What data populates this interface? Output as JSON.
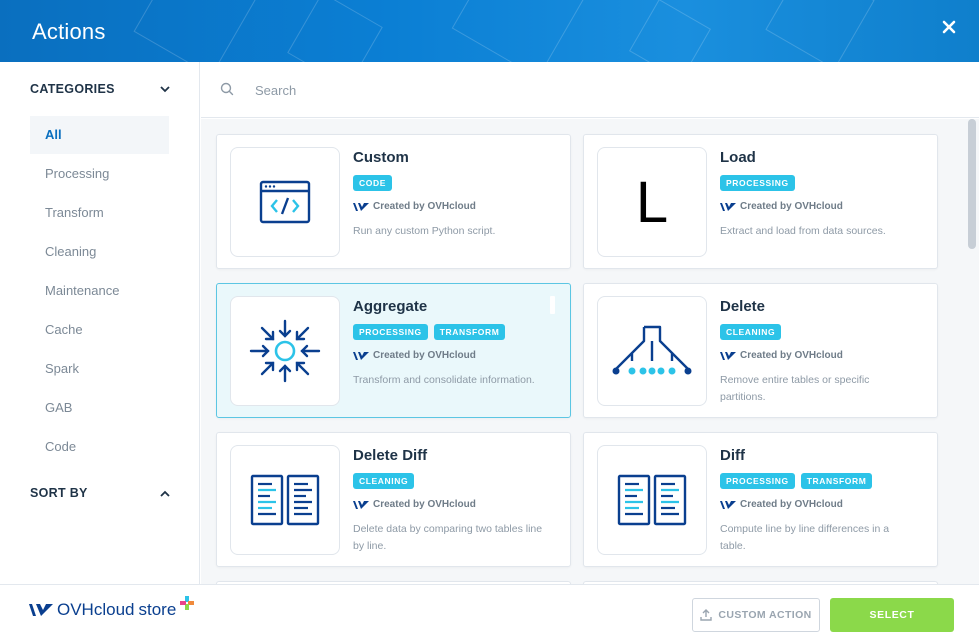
{
  "header": {
    "title": "Actions"
  },
  "sidebar": {
    "categories_label": "CATEGORIES",
    "sort_label": "SORT BY",
    "items": [
      {
        "label": "All",
        "active": true
      },
      {
        "label": "Processing"
      },
      {
        "label": "Transform"
      },
      {
        "label": "Cleaning"
      },
      {
        "label": "Maintenance"
      },
      {
        "label": "Cache"
      },
      {
        "label": "Spark"
      },
      {
        "label": "GAB"
      },
      {
        "label": "Code"
      }
    ]
  },
  "search": {
    "placeholder": "Search"
  },
  "cards": [
    {
      "title": "Custom",
      "tags": [
        "CODE"
      ],
      "creator": "Created by OVHcloud",
      "description": "Run any custom Python script.",
      "icon": "code-window-icon"
    },
    {
      "title": "Load",
      "tags": [
        "PROCESSING"
      ],
      "creator": "Created by OVHcloud",
      "description": "Extract and load from data sources.",
      "icon": "letter-l-icon",
      "icon_text": "L"
    },
    {
      "title": "Aggregate",
      "tags": [
        "PROCESSING",
        "TRANSFORM"
      ],
      "creator": "Created by OVHcloud",
      "description": "Transform and consolidate information.",
      "icon": "aggregate-arrows-icon",
      "selected": true
    },
    {
      "title": "Delete",
      "tags": [
        "CLEANING"
      ],
      "creator": "Created by OVHcloud",
      "description": "Remove entire tables or specific partitions.",
      "icon": "funnel-dots-icon"
    },
    {
      "title": "Delete Diff",
      "tags": [
        "CLEANING"
      ],
      "creator": "Created by OVHcloud",
      "description": "Delete data by comparing two tables line by line.",
      "icon": "two-documents-icon"
    },
    {
      "title": "Diff",
      "tags": [
        "PROCESSING",
        "TRANSFORM"
      ],
      "creator": "Created by OVHcloud",
      "description": "Compute line by line differences in a table.",
      "icon": "two-documents-icon"
    }
  ],
  "footer": {
    "brand": "OVHcloud",
    "store": "store",
    "custom_action_label": "CUSTOM ACTION",
    "select_label": "SELECT"
  },
  "colors": {
    "header": "#0b7fd4",
    "tag": "#2cc3e8",
    "select": "#8bd94a",
    "icon_primary": "#0a3f8f",
    "icon_accent": "#2cc3e8"
  }
}
